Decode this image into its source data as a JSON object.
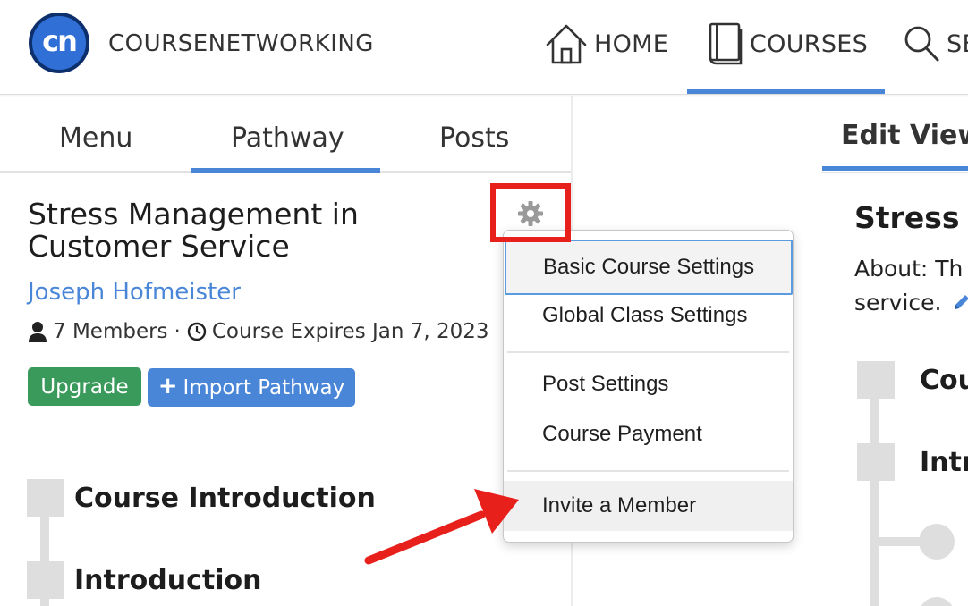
{
  "header": {
    "logo_text": "cn",
    "brand": "COURSENETWORKING",
    "nav": [
      {
        "label": "HOME",
        "icon": "home-icon"
      },
      {
        "label": "COURSES",
        "icon": "book-icon"
      },
      {
        "label": "SE",
        "icon": "search-icon"
      }
    ]
  },
  "left_tabs": [
    "Menu",
    "Pathway",
    "Posts"
  ],
  "course": {
    "title": "Stress Management in Customer Service",
    "owner": "Joseph Hofmeister",
    "members": "7 Members",
    "separator": "·",
    "expires": "Course Expires Jan 7, 2023",
    "upgrade_label": "Upgrade",
    "import_label": "Import Pathway",
    "import_plus": "+"
  },
  "pathway": [
    "Course Introduction",
    "Introduction"
  ],
  "gear_menu": {
    "items": [
      "Basic Course Settings",
      "Global Class Settings",
      "Post Settings",
      "Course Payment",
      "Invite a Member"
    ]
  },
  "right_pane": {
    "tab": "Edit View",
    "title": "Stress M",
    "about_line1": "About: Th",
    "about_line2": "service.",
    "pathway_items": [
      "Cou",
      "Intro"
    ]
  },
  "colors": {
    "accent": "#4a86d8",
    "upgrade_green": "#3a9a5b",
    "highlight_red": "#e8201c",
    "logo_blue": "#2f6fd6"
  }
}
